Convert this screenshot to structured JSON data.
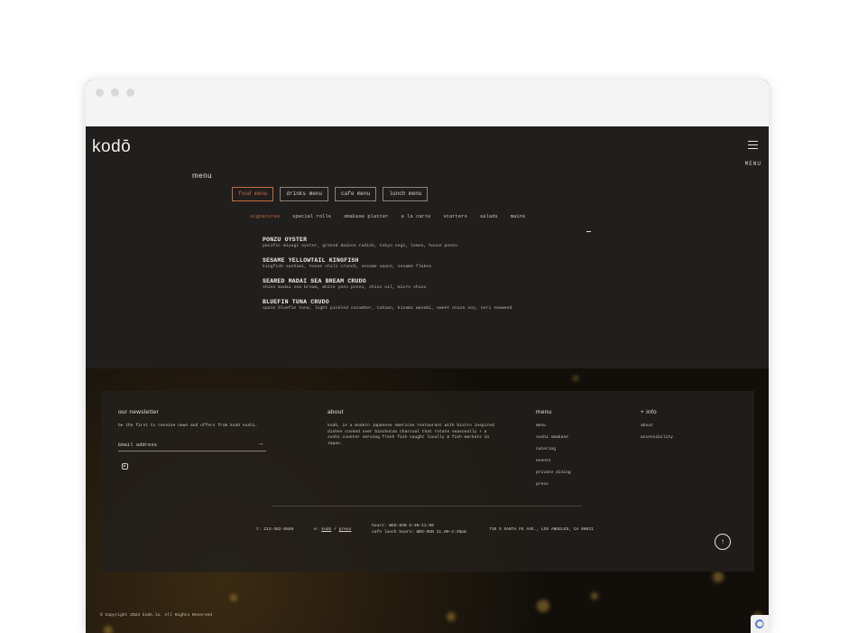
{
  "header": {
    "logo": "kodō",
    "menu_label": "MENU"
  },
  "menu": {
    "title": "menu",
    "tabs": [
      "food menu",
      "drinks menu",
      "cafe menu",
      "lunch menu"
    ],
    "active_tab": "food menu",
    "categories": [
      "signatures",
      "special rolls",
      "omakase platter",
      "a la carte",
      "starters",
      "salads",
      "mains"
    ],
    "active_category": "signatures",
    "items": [
      {
        "name": "PONZU OYSTER",
        "desc": "pacific miyagi oyster, grated daikon radish, tokyo negi, lemon, house ponzu"
      },
      {
        "name": "SESAME YELLOWTAIL KINGFISH",
        "desc": "kingfish sashimi, house chili crunch, sesame sauce, sesame flakes"
      },
      {
        "name": "SEARED MADAI SEA BREAM CRUDO",
        "desc": "shiso madai sea bream, white yuzu ponzu, shiso oil, micro shiso"
      },
      {
        "name": "BLUEFIN TUNA CRUDO",
        "desc": "spain bluefin tuna, light pickled cucumber, takuan, kizami wasabi, sweet onion soy, nori seaweed"
      }
    ]
  },
  "footer": {
    "newsletter": {
      "title": "our newsletter",
      "text": "be the first to receive news and offers from kodō sushi.",
      "email_placeholder": "Email address"
    },
    "about": {
      "title": "about",
      "text": "kodō, is a modern Japanese American restaurant with bistro inspired dishes cooked over binchotan charcoal that rotate seasonally + a sushi counter serving fresh fish caught locally & fish markets in Japan."
    },
    "menu_col": {
      "title": "menu",
      "links": [
        "menu",
        "sushi omakase",
        "catering",
        "events",
        "private dining",
        "press"
      ]
    },
    "info_col": {
      "title": "+ info",
      "links": [
        "about",
        "accessibility"
      ]
    },
    "contact": {
      "phone": "t: 213-382-8888",
      "email_prefix": "e:",
      "email_link1": "kodō",
      "email_sep": "/",
      "email_link2": "press",
      "hours": "hours: WED–SUN 5:30–11:00",
      "cafe_hours": "cafe lunch hours: WED–SUN 11.00–2:30pm",
      "address": "710 S SANTA FE AVE., LOS ANGELES, CA 90021"
    },
    "copyright": "© Copyright 2023 kodō.la. All Rights Reserved"
  }
}
